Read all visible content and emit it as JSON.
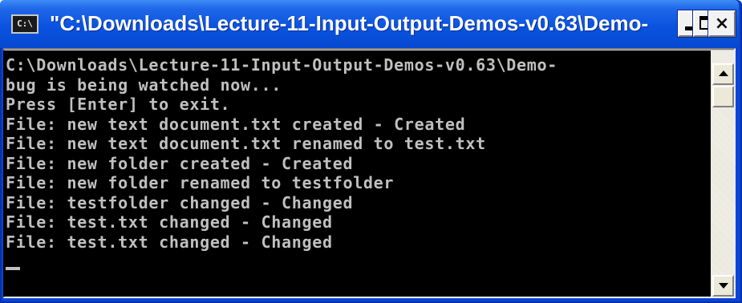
{
  "window": {
    "title": "\"C:\\Downloads\\Lecture-11-Input-Output-Demos-v0.63\\Demo-",
    "icon_text": "C:\\",
    "icon_name": "console-icon"
  },
  "controls": {
    "minimize_icon": "minimize-icon",
    "maximize_icon": "maximize-icon",
    "close_icon": "close-icon",
    "close_glyph": "×"
  },
  "console": {
    "lines": [
      "C:\\Downloads\\Lecture-11-Input-Output-Demos-v0.63\\Demo-",
      "bug is being watched now...",
      "Press [Enter] to exit.",
      "File: new text document.txt created - Created",
      "File: new text document.txt renamed to test.txt",
      "File: new folder created - Created",
      "File: new folder renamed to testfolder",
      "File: testfolder changed - Changed",
      "File: test.txt changed - Changed",
      "File: test.txt changed - Changed"
    ],
    "text_color": "#c0c0c0",
    "background_color": "#000000"
  },
  "colors": {
    "titlebar": "#0a53e0",
    "frame": "#0a44d8"
  }
}
